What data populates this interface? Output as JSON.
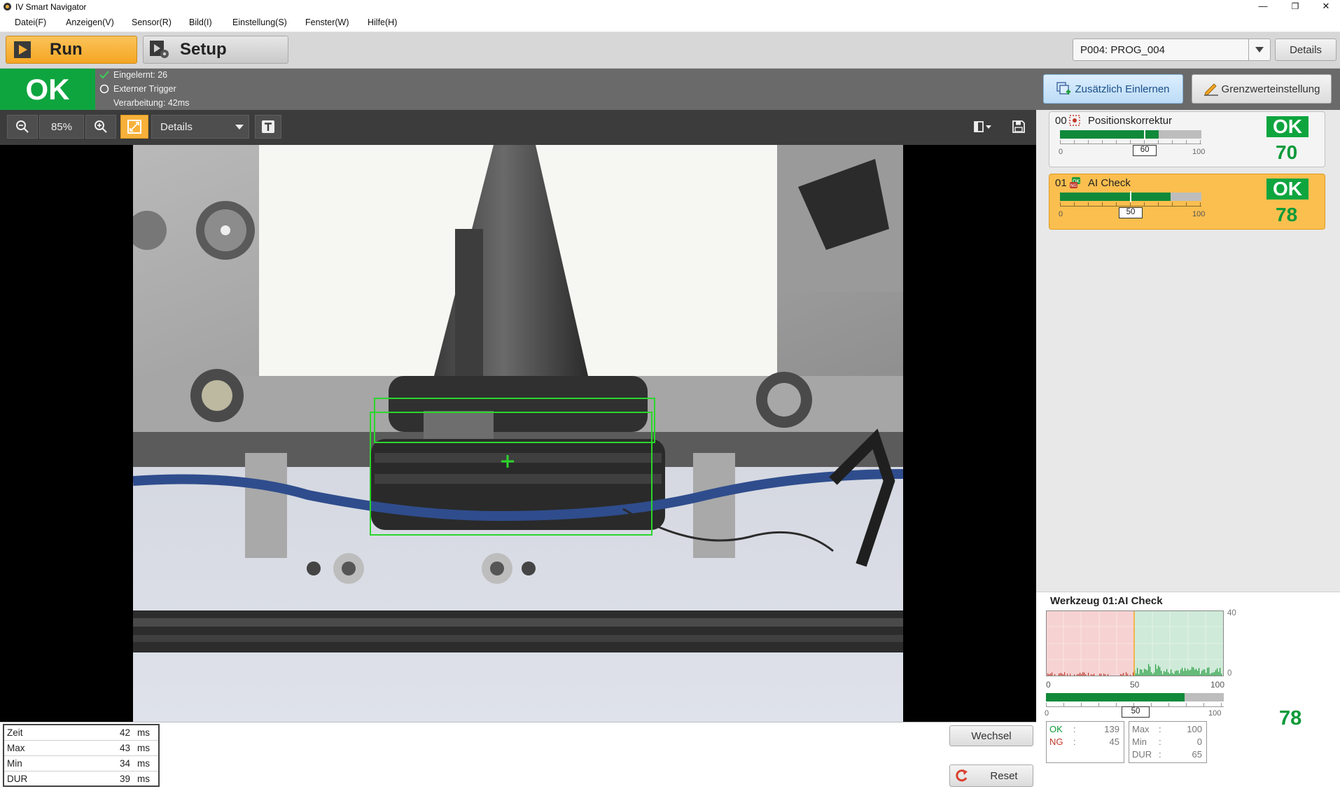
{
  "app": {
    "title": "IV Smart Navigator"
  },
  "window": {
    "minimize": "—",
    "restore": "❐",
    "close": "✕"
  },
  "menu": [
    "Datei(F)",
    "Anzeigen(V)",
    "Sensor(R)",
    "Bild(I)",
    "Einstellung(S)",
    "Fenster(W)",
    "Hilfe(H)"
  ],
  "toolbar": {
    "run_label": "Run",
    "setup_label": "Setup",
    "program": "P004: PROG_004",
    "details_label": "Details"
  },
  "status": {
    "result": "OK",
    "learned": "Eingelernt: 26",
    "trigger": "Externer Trigger",
    "processing": "Verarbeitung: 42ms"
  },
  "view": {
    "zoom": "85%",
    "display_mode": "Details"
  },
  "right": {
    "add_learn_label": "Zusätzlich Einlernen",
    "threshold_label": "Grenzwerteinstellung",
    "tools": [
      {
        "num": "00",
        "name": "Positionskorrektur",
        "result": "OK",
        "score": "70",
        "threshold": "60",
        "min": "0",
        "max": "100",
        "fill_fraction": 0.7,
        "threshold_fraction": 0.6
      },
      {
        "num": "01",
        "name": "AI Check",
        "result": "OK",
        "score": "78",
        "threshold": "50",
        "min": "0",
        "max": "100",
        "fill_fraction": 0.78,
        "threshold_fraction": 0.5
      }
    ]
  },
  "histogram": {
    "title": "Werkzeug 01:AI Check",
    "y_max": "40",
    "y_min": "0",
    "x_ticks": [
      "0",
      "50",
      "100"
    ],
    "score": "78",
    "threshold": "50",
    "bar_min": "0",
    "bar_max": "100",
    "fill_fraction": 0.78,
    "ok_label": "OK",
    "ok_value": "139",
    "ng_label": "NG",
    "ng_value": "45",
    "max_label": "Max",
    "max_value": "100",
    "min_label": "Min",
    "min_value": "0",
    "dur_label": "DUR",
    "dur_value": "65"
  },
  "timing": [
    {
      "label": "Zeit",
      "value": "42",
      "unit": "ms"
    },
    {
      "label": "Max",
      "value": "43",
      "unit": "ms"
    },
    {
      "label": "Min",
      "value": "34",
      "unit": "ms"
    },
    {
      "label": "DUR",
      "value": "39",
      "unit": "ms"
    }
  ],
  "bottom": {
    "wechsel_label": "Wechsel",
    "reset_label": "Reset"
  },
  "colors": {
    "ok_green": "#0ea53f",
    "run_orange": "#f7b13a",
    "highlight_card": "#fbbf4f"
  }
}
